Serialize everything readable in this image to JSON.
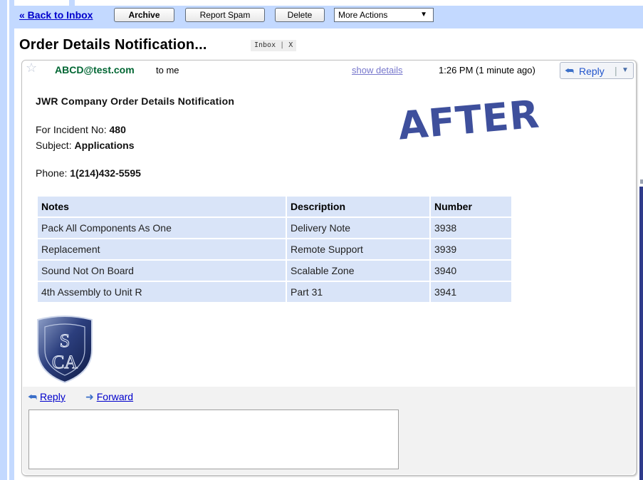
{
  "toolbar": {
    "back_link": "« Back to Inbox",
    "archive": "Archive",
    "report_spam": "Report Spam",
    "delete": "Delete",
    "more_actions": "More Actions",
    "more_actions_caret": "▼"
  },
  "header": {
    "subject": "Order Details Notification...",
    "label": "Inbox",
    "label_remove": "X"
  },
  "message": {
    "sender": "ABCD@test.com",
    "recipient": "to me",
    "show_details": "show details",
    "time": "1:26 PM (1 minute ago)",
    "reply_button": "Reply"
  },
  "body": {
    "heading": "JWR Company Order Details Notification",
    "incident_label": "For Incident No: ",
    "incident_value": "480",
    "subject_label": "Subject: ",
    "subject_value": "Applications",
    "phone_label": "Phone: ",
    "phone_value": "1(214)432-5595",
    "stamp": "AFTER"
  },
  "table": {
    "headers": [
      "Notes",
      "Description",
      "Number"
    ],
    "rows": [
      [
        "Pack All Components As One",
        "Delivery Note",
        "3938"
      ],
      [
        "Replacement",
        "Remote Support",
        "3939"
      ],
      [
        "Sound Not On Board",
        "Scalable Zone",
        "3940"
      ],
      [
        "4th Assembly to Unit R",
        "Part 31",
        "3941"
      ]
    ]
  },
  "logo": {
    "letters": "SCA"
  },
  "footer": {
    "reply": "Reply",
    "forward": "Forward"
  },
  "colors": {
    "toolbar_bg": "#c3d9ff",
    "sender": "#006633",
    "link": "#0000cc",
    "stamp": "#3e4f9c",
    "table_cell": "#d9e4f8"
  }
}
